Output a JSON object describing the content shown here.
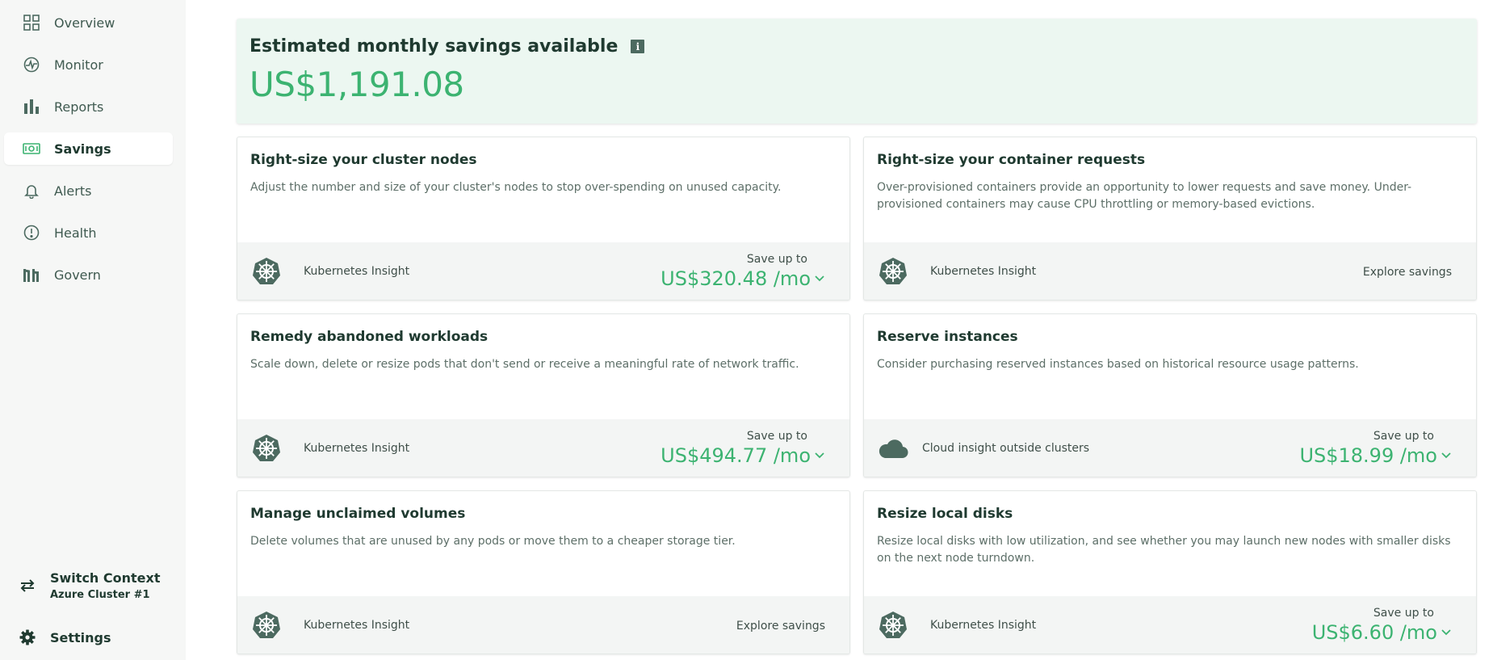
{
  "sidebar": {
    "items": [
      {
        "label": "Overview",
        "icon": "grid-icon",
        "active": false
      },
      {
        "label": "Monitor",
        "icon": "monitor-icon",
        "active": false
      },
      {
        "label": "Reports",
        "icon": "bar-chart-icon",
        "active": false
      },
      {
        "label": "Savings",
        "icon": "money-icon",
        "active": true
      },
      {
        "label": "Alerts",
        "icon": "bell-icon",
        "active": false
      },
      {
        "label": "Health",
        "icon": "alert-circle-icon",
        "active": false
      },
      {
        "label": "Govern",
        "icon": "govern-icon",
        "active": false
      }
    ],
    "context": {
      "title": "Switch Context",
      "subtitle": "Azure Cluster #1"
    },
    "settings_label": "Settings"
  },
  "hero": {
    "title": "Estimated monthly savings available",
    "info_glyph": "i",
    "amount": "US$1,191.08"
  },
  "cards": [
    {
      "title": "Right-size your cluster nodes",
      "description": "Adjust the number and size of your cluster's nodes to stop over-spending on unused capacity.",
      "insight_label": "Kubernetes Insight",
      "insight_icon": "kubernetes-icon",
      "save_label": "Save up to",
      "amount": "US$320.48 /mo"
    },
    {
      "title": "Right-size your container requests",
      "description": "Over-provisioned containers provide an opportunity to lower requests and save money. Under-provisioned containers may cause CPU throttling or memory-based evictions.",
      "insight_label": "Kubernetes Insight",
      "insight_icon": "kubernetes-icon",
      "explore_label": "Explore savings"
    },
    {
      "title": "Remedy abandoned workloads",
      "description": "Scale down, delete or resize pods that don't send or receive a meaningful rate of network traffic.",
      "insight_label": "Kubernetes Insight",
      "insight_icon": "kubernetes-icon",
      "save_label": "Save up to",
      "amount": "US$494.77 /mo"
    },
    {
      "title": "Reserve instances",
      "description": "Consider purchasing reserved instances based on historical resource usage patterns.",
      "insight_label": "Cloud insight outside clusters",
      "insight_icon": "cloud-icon",
      "save_label": "Save up to",
      "amount": "US$18.99 /mo"
    },
    {
      "title": "Manage unclaimed volumes",
      "description": "Delete volumes that are unused by any pods or move them to a cheaper storage tier.",
      "insight_label": "Kubernetes Insight",
      "insight_icon": "kubernetes-icon",
      "explore_label": "Explore savings"
    },
    {
      "title": "Resize local disks",
      "description": "Resize local disks with low utilization, and see whether you may launch new nodes with smaller disks on the next node turndown.",
      "insight_label": "Kubernetes Insight",
      "insight_icon": "kubernetes-icon",
      "save_label": "Save up to",
      "amount": "US$6.60 /mo"
    }
  ],
  "colors": {
    "accent_green": "#3cb371",
    "hero_bg": "#ecf7f1",
    "icon_dark": "#4c6a60",
    "sidebar_bg": "#f6f7f6"
  }
}
